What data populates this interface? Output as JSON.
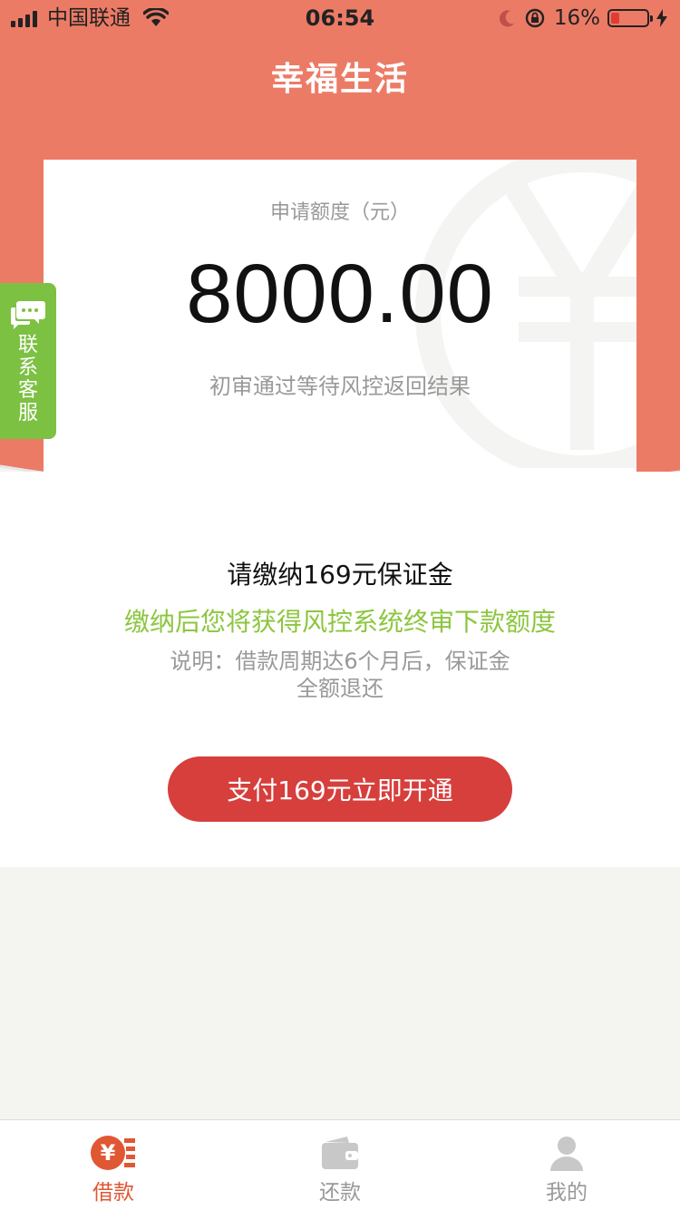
{
  "status_bar": {
    "carrier": "中国联通",
    "time": "06:54",
    "battery": "16%"
  },
  "nav": {
    "title": "幸福生活"
  },
  "card": {
    "label": "申请额度（元）",
    "amount": "8000.00",
    "status": "初审通过等待风控返回结果"
  },
  "customer_service": {
    "label": "联系客服"
  },
  "deposit": {
    "title": "请缴纳169元保证金",
    "subtitle": "缴纳后您将获得风控系统终审下款额度",
    "note_line1": "说明：借款周期达6个月后，保证金",
    "note_line2": "全额退还"
  },
  "pay_button": {
    "label": "支付169元立即开通"
  },
  "tabbar": {
    "items": [
      {
        "label": "借款",
        "active": true,
        "icon": "loan-icon"
      },
      {
        "label": "还款",
        "active": false,
        "icon": "wallet-icon"
      },
      {
        "label": "我的",
        "active": false,
        "icon": "user-icon"
      }
    ]
  },
  "colors": {
    "header": "#ec7b66",
    "accent_green": "#8cc63f",
    "button": "#d63f3c",
    "active_tab": "#e05733"
  }
}
